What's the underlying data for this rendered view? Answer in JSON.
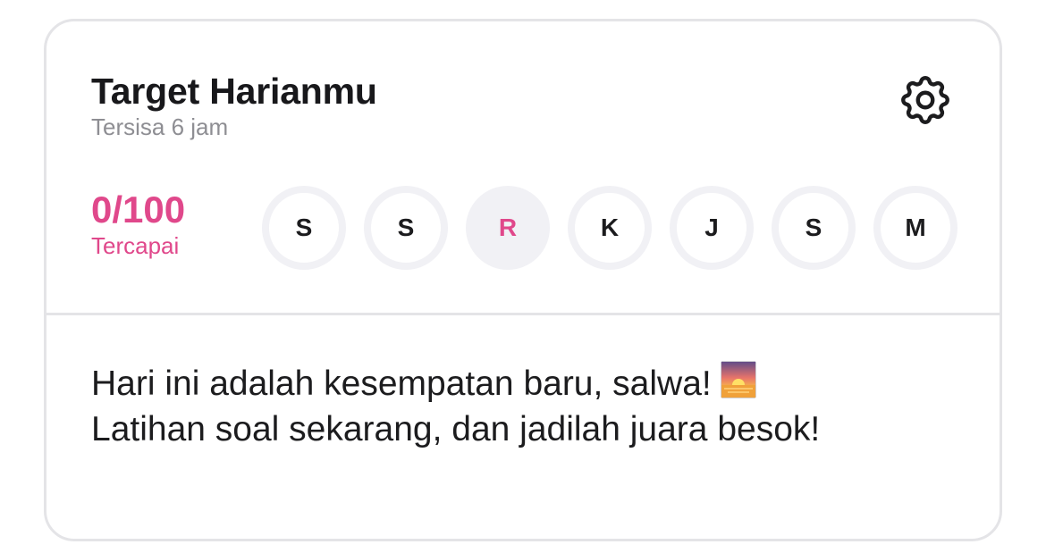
{
  "card": {
    "title": "Target Harianmu",
    "subtitle": "Tersisa 6 jam",
    "settings_icon": "gear-icon",
    "progress": {
      "value": "0/100",
      "label": "Tercapai"
    },
    "days": [
      {
        "label": "S",
        "today": false
      },
      {
        "label": "S",
        "today": false
      },
      {
        "label": "R",
        "today": true
      },
      {
        "label": "K",
        "today": false
      },
      {
        "label": "J",
        "today": false
      },
      {
        "label": "S",
        "today": false
      },
      {
        "label": "M",
        "today": false
      }
    ],
    "message": "Hari ini adalah kesempatan baru, salwa!",
    "message_line2": "Latihan soal sekarang, dan jadilah juara besok!",
    "message_emoji_icon": "sunrise-icon"
  },
  "colors": {
    "accent": "#e0488b",
    "border": "#e4e4e7",
    "day_ring": "#f1f1f5",
    "text": "#1c1c1e",
    "muted": "#8e8e93"
  }
}
